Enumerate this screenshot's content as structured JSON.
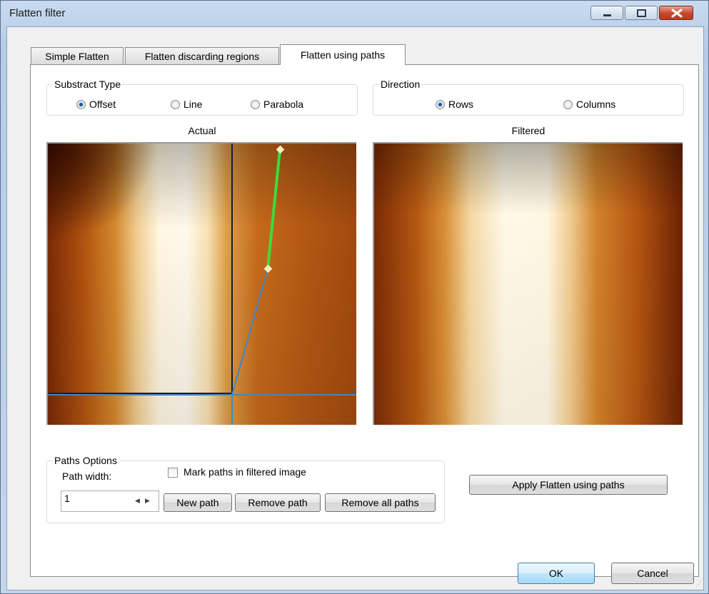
{
  "window": {
    "title": "Flatten filter"
  },
  "tabs": [
    {
      "label": "Simple Flatten",
      "selected": false
    },
    {
      "label": "Flatten discarding regions",
      "selected": false
    },
    {
      "label": "Flatten using paths",
      "selected": true
    }
  ],
  "substract_type": {
    "legend": "Substract Type",
    "options": [
      {
        "label": "Offset",
        "checked": true
      },
      {
        "label": "Line",
        "checked": false
      },
      {
        "label": "Parabola",
        "checked": false
      }
    ]
  },
  "direction": {
    "legend": "Direction",
    "options": [
      {
        "label": "Rows",
        "checked": true
      },
      {
        "label": "Columns",
        "checked": false
      }
    ]
  },
  "images": {
    "actual_caption": "Actual",
    "filtered_caption": "Filtered"
  },
  "paths_options": {
    "legend": "Paths Options",
    "path_width_label": "Path width:",
    "path_width_value": "1",
    "mark_paths_label": "Mark paths in filtered image",
    "mark_paths_checked": false,
    "new_path": "New path",
    "remove_path": "Remove path",
    "remove_all_paths": "Remove all paths"
  },
  "apply_button": "Apply Flatten using paths",
  "footer": {
    "ok": "OK",
    "cancel": "Cancel"
  },
  "colors": {
    "title_bar": "#c3d5ea",
    "path_active": "#3cdc3c",
    "path_line": "#3b88c9",
    "path_point": "#f7f0a0",
    "afm_dark": "#3a0e02",
    "afm_mid": "#c86a18",
    "afm_light": "#fff6e0"
  }
}
